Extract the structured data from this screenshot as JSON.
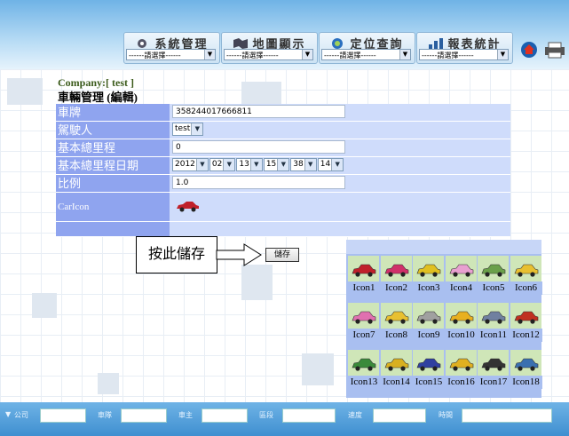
{
  "header": {
    "menus": [
      {
        "title": "系統管理",
        "select": "------請選擇------",
        "icon": "gear-icon"
      },
      {
        "title": "地圖顯示",
        "select": "------請選擇------",
        "icon": "map-icon"
      },
      {
        "title": "定位查詢",
        "select": "------請選擇------",
        "icon": "globe-search-icon"
      },
      {
        "title": "報表統計",
        "select": "------請選擇------",
        "icon": "bar-chart-icon"
      }
    ],
    "right_icons": [
      "home-icon",
      "printer-icon"
    ]
  },
  "company": "Company:[ test ]",
  "page_title": "車輛管理 (編輯)",
  "form": {
    "plate_label": "車牌",
    "plate_value": "358244017666811",
    "driver_label": "駕駛人",
    "driver_value": "test",
    "mileage_label": "基本總里程",
    "mileage_value": "0",
    "date_label": "基本總里程日期",
    "date_year": "2012",
    "date_month": "02",
    "date_day": "13",
    "date_hour": "15",
    "date_minute": "38",
    "date_second": "14",
    "ratio_label": "比例",
    "ratio_value": "1.0",
    "caricon_label": "CarIcon"
  },
  "annotation": "按此儲存",
  "save_label": "儲存",
  "icons": [
    "Icon1",
    "Icon2",
    "Icon3",
    "Icon4",
    "Icon5",
    "Icon6",
    "Icon7",
    "Icon8",
    "Icon9",
    "Icon10",
    "Icon11",
    "Icon12",
    "Icon13",
    "Icon14",
    "Icon15",
    "Icon16",
    "Icon17",
    "Icon18"
  ],
  "icon_colors": [
    "#c0202a",
    "#d0306a",
    "#e0c020",
    "#e8a0d0",
    "#6aa04a",
    "#e8c030",
    "#e070b0",
    "#e8c030",
    "#a0a0a0",
    "#e8b020",
    "#7080a0",
    "#c03020",
    "#3a8a3a",
    "#d8b020",
    "#3040a0",
    "#e0b020",
    "#333333",
    "#3a70b0"
  ],
  "footer": {
    "labels": [
      "公司",
      "車隊",
      "車主",
      "區段",
      "速度",
      "時間"
    ]
  }
}
